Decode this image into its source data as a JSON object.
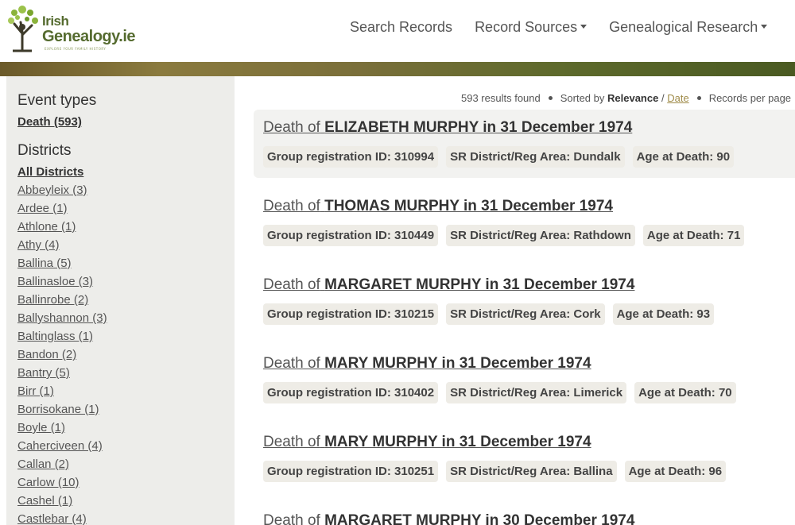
{
  "brand": {
    "line1": "Irish",
    "line2": "Genealogy.ie",
    "tagline": "EXPLORE YOUR FAMILY HISTORY"
  },
  "nav": {
    "search_records": "Search Records",
    "record_sources": "Record Sources",
    "genealogical_research": "Genealogical Research"
  },
  "sidebar": {
    "event_types_heading": "Event types",
    "event_types": [
      {
        "label": "Death (593)"
      }
    ],
    "districts_heading": "Districts",
    "districts": [
      {
        "label": "All Districts"
      },
      {
        "label": "Abbeyleix (3)"
      },
      {
        "label": "Ardee (1)"
      },
      {
        "label": "Athlone (1)"
      },
      {
        "label": "Athy (4)"
      },
      {
        "label": "Ballina (5)"
      },
      {
        "label": "Ballinasloe (3)"
      },
      {
        "label": "Ballinrobe (2)"
      },
      {
        "label": "Ballyshannon (3)"
      },
      {
        "label": "Baltinglass (1)"
      },
      {
        "label": "Bandon (2)"
      },
      {
        "label": "Bantry (5)"
      },
      {
        "label": "Birr (1)"
      },
      {
        "label": "Borrisokane (1)"
      },
      {
        "label": "Boyle (1)"
      },
      {
        "label": "Caherciveen (4)"
      },
      {
        "label": "Callan (2)"
      },
      {
        "label": "Carlow (10)"
      },
      {
        "label": "Cashel (1)"
      },
      {
        "label": "Castlebar (4)"
      }
    ]
  },
  "results_meta": {
    "count": "593 results found",
    "sorted_by": "Sorted by",
    "relevance": "Relevance",
    "slash": "/",
    "date": "Date",
    "records_per_page": "Records per page"
  },
  "records": [
    {
      "prefix": "Death of",
      "name": "ELIZABETH MURPHY in 31 December 1974",
      "group_id": "Group registration ID: 310994",
      "district": "SR District/Reg Area: Dundalk",
      "age": "Age at Death: 90"
    },
    {
      "prefix": "Death of",
      "name": "THOMAS MURPHY in 31 December 1974",
      "group_id": "Group registration ID: 310449",
      "district": "SR District/Reg Area: Rathdown",
      "age": "Age at Death: 71"
    },
    {
      "prefix": "Death of",
      "name": "MARGARET MURPHY in 31 December 1974",
      "group_id": "Group registration ID: 310215",
      "district": "SR District/Reg Area: Cork",
      "age": "Age at Death: 93"
    },
    {
      "prefix": "Death of",
      "name": "MARY MURPHY in 31 December 1974",
      "group_id": "Group registration ID: 310402",
      "district": "SR District/Reg Area: Limerick",
      "age": "Age at Death: 70"
    },
    {
      "prefix": "Death of",
      "name": "MARY MURPHY in 31 December 1974",
      "group_id": "Group registration ID: 310251",
      "district": "SR District/Reg Area: Ballina",
      "age": "Age at Death: 96"
    },
    {
      "prefix": "Death of",
      "name": "MARGARET MURPHY in 30 December 1974",
      "group_id": "",
      "district": "",
      "age": ""
    }
  ]
}
